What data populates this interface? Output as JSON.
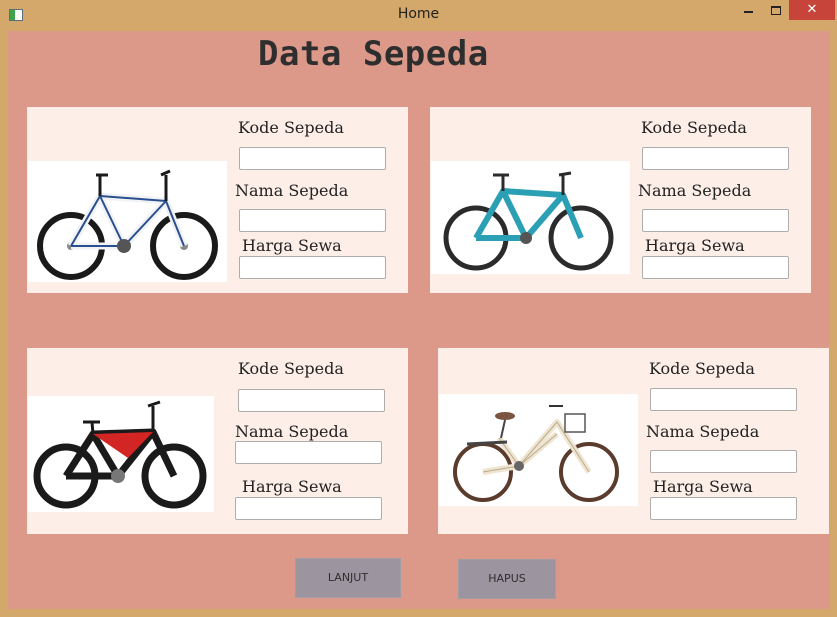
{
  "window": {
    "title": "Home",
    "close_glyph": "✕"
  },
  "page": {
    "heading": "Data Sepeda"
  },
  "cards": [
    {
      "kode_label": "Kode Sepeda",
      "nama_label": "Nama Sepeda",
      "harga_label": "Harga Sewa",
      "kode_value": "",
      "nama_value": "",
      "harga_value": "",
      "bike_color": "#f0f2f6",
      "accent": "#2a4f8f"
    },
    {
      "kode_label": "Kode Sepeda",
      "nama_label": "Nama Sepeda",
      "harga_label": "Harga Sewa",
      "kode_value": "",
      "nama_value": "",
      "harga_value": "",
      "bike_color": "#2b9fb3",
      "accent": "#1c6f7e"
    },
    {
      "kode_label": "Kode Sepeda",
      "nama_label": "Nama Sepeda",
      "harga_label": "Harga Sewa",
      "kode_value": "",
      "nama_value": "",
      "harga_value": "",
      "bike_color": "#d42525",
      "accent": "#1a1a1a"
    },
    {
      "kode_label": "Kode Sepeda",
      "nama_label": "Nama Sepeda",
      "harga_label": "Harga Sewa",
      "kode_value": "",
      "nama_value": "",
      "harga_value": "",
      "bike_color": "#efe4cf",
      "accent": "#7b5540"
    }
  ],
  "buttons": {
    "next_label": "LANJUT",
    "delete_label": "HAPUS"
  },
  "colors": {
    "titlebar": "#d4a76a",
    "client_bg": "#dc998a",
    "card_bg": "#fdeee8",
    "button_bg": "#9c949e",
    "close_button": "#c7443b"
  }
}
